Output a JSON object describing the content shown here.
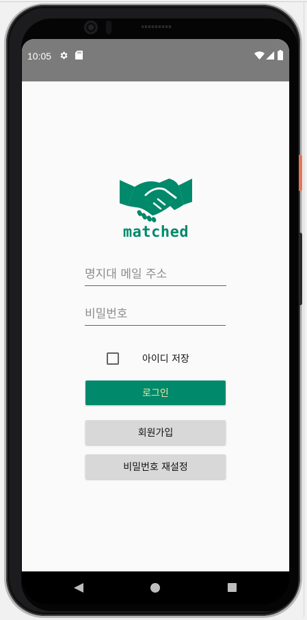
{
  "status_bar": {
    "time": "10:05",
    "icons": [
      "gear-icon",
      "sd-card-icon",
      "wifi-icon",
      "signal-icon",
      "battery-icon"
    ]
  },
  "logo": {
    "icon": "handshake-icon",
    "text": "matched",
    "color": "#00896b"
  },
  "form": {
    "email_placeholder": "명지대 메일 주소",
    "password_placeholder": "비밀번호",
    "save_id_label": "아이디 저장",
    "save_id_checked": false
  },
  "buttons": {
    "login": "로그인",
    "signup": "회원가입",
    "reset_password": "비밀번호 재설정"
  },
  "nav_bar": {
    "icons": [
      "back-icon",
      "home-icon",
      "recents-icon"
    ]
  },
  "colors": {
    "primary": "#00896b",
    "login_text": "#f4e3a3",
    "secondary_button": "#d8d8d8",
    "status_bar": "#7b7b7b"
  }
}
